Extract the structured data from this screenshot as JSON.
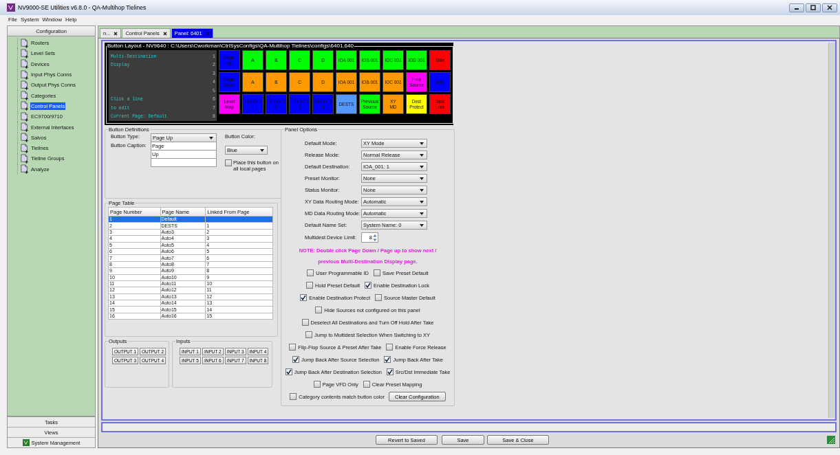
{
  "window": {
    "title": "NV9000-SE Utilities v6.8.0 - QA-Multihop Tielines"
  },
  "menu": [
    "File",
    "System",
    "Window",
    "Help"
  ],
  "sidebar": {
    "header": "Configuration",
    "items": [
      {
        "label": "Routers",
        "selected": false
      },
      {
        "label": "Level Sets",
        "selected": false
      },
      {
        "label": "Devices",
        "selected": false
      },
      {
        "label": "Input Phys Conns",
        "selected": false
      },
      {
        "label": "Output Phys Conns",
        "selected": false
      },
      {
        "label": "Categories",
        "selected": false
      },
      {
        "label": "Control Panels",
        "selected": true
      },
      {
        "label": "EC9700/9710",
        "selected": false
      },
      {
        "label": "External Interfaces",
        "selected": false
      },
      {
        "label": "Salvos",
        "selected": false
      },
      {
        "label": "Tielines",
        "selected": false
      },
      {
        "label": "Tieline Groups",
        "selected": false
      },
      {
        "label": "Analyze",
        "selected": false
      }
    ],
    "footer": [
      {
        "label": "Tasks"
      },
      {
        "label": "Views"
      },
      {
        "label": "System Management",
        "kind": "logo"
      }
    ]
  },
  "tabs": [
    {
      "label": "n...",
      "selected": false
    },
    {
      "label": "Control Panels",
      "selected": false
    },
    {
      "label": "Panel: 6401",
      "selected": true
    }
  ],
  "button_layout": {
    "title": "Button Layout - NV9640 : C:\\Users\\Cworkman\\CtrlSysConfigs\\QA-Multihop Tielines\\configs\\6401.640",
    "display_lines": [
      {
        "number": "1",
        "text": "Multi-Destination"
      },
      {
        "number": "2",
        "text": "Display"
      },
      {
        "number": "3"
      },
      {
        "number": "4"
      },
      {
        "number": "5"
      },
      {
        "number": "6",
        "text": "Click a line"
      },
      {
        "number": "7",
        "text": "to edit"
      },
      {
        "number": "8",
        "text": "Current Page: Default"
      }
    ],
    "buttons": [
      {
        "caption": [
          "Page",
          "Up"
        ],
        "color": "#0000ff"
      },
      {
        "caption": [
          "A"
        ],
        "color": "#00ff00"
      },
      {
        "caption": [
          "B"
        ],
        "color": "#00ff00"
      },
      {
        "caption": [
          "C"
        ],
        "color": "#00ff00"
      },
      {
        "caption": [
          "D"
        ],
        "color": "#00ff00"
      },
      {
        "caption": [
          "IOA 001"
        ],
        "color": "#00ff00"
      },
      {
        "caption": [
          "IOB 001"
        ],
        "color": "#00ff00"
      },
      {
        "caption": [
          "IOC 001"
        ],
        "color": "#00ff00"
      },
      {
        "caption": [
          "IOD 001"
        ],
        "color": "#00ff00"
      },
      {
        "caption": [
          "Take"
        ],
        "color": "#ff0000"
      },
      {
        "caption": [
          "Page",
          "Down"
        ],
        "color": "#0000ff"
      },
      {
        "caption": [
          "A"
        ],
        "color": "#ff9900"
      },
      {
        "caption": [
          "B"
        ],
        "color": "#ff9900"
      },
      {
        "caption": [
          "C"
        ],
        "color": "#ff9900"
      },
      {
        "caption": [
          "D"
        ],
        "color": "#ff9900"
      },
      {
        "caption": [
          "IOA 001"
        ],
        "color": "#ff9900"
      },
      {
        "caption": [
          "IOB 001"
        ],
        "color": "#ff9900"
      },
      {
        "caption": [
          "IOC 001"
        ],
        "color": "#ff9900"
      },
      {
        "caption": [
          "Free",
          "Source"
        ],
        "color": "#ff00ff"
      },
      {
        "caption": [
          "Info"
        ],
        "color": "#0000ff"
      },
      {
        "caption": [
          "Level",
          "Map"
        ],
        "color": "#ff00ff"
      },
      {
        "caption": [
          "SELECT",
          "1"
        ],
        "color": "#0000ff"
      },
      {
        "caption": [
          "SELECT",
          "2"
        ],
        "color": "#0000ff"
      },
      {
        "caption": [
          "SELECT",
          "3"
        ],
        "color": "#0000ff"
      },
      {
        "caption": [
          "SELECT",
          "4"
        ],
        "color": "#0000ff"
      },
      {
        "caption": [
          "DESTS"
        ],
        "color": "#5599ff"
      },
      {
        "caption": [
          "Previous",
          "Source"
        ],
        "color": "#00ff00"
      },
      {
        "caption": [
          "XY",
          "MD"
        ],
        "color": "#ff9900"
      },
      {
        "caption": [
          "Dest",
          "Protect"
        ],
        "color": "#ffff00"
      },
      {
        "caption": [
          "Dest",
          "Lock"
        ],
        "color": "#ff0000"
      }
    ]
  },
  "button_definitions": {
    "title": "Button Definitions",
    "type_label": "Button Type:",
    "type_value": "Page Up",
    "caption_label": "Button Caption:",
    "caption_lines": [
      "Page",
      "Up"
    ],
    "color_label": "Button Color:",
    "color_value": "Blue",
    "all_pages": {
      "label": "Place this button on all local pages",
      "checked": false
    }
  },
  "page_table": {
    "title": "Page Table",
    "columns": [
      "Page Number",
      "Page Name",
      "Linked From Page"
    ],
    "rows": [
      {
        "cells": [
          "1",
          "Default"
        ],
        "selected": true
      },
      {
        "cells": [
          "2",
          "DESTS",
          "1"
        ],
        "selected": false
      },
      {
        "cells": [
          "3",
          "Auto3",
          "2"
        ],
        "selected": false
      },
      {
        "cells": [
          "4",
          "Auto4",
          "3"
        ],
        "selected": false
      },
      {
        "cells": [
          "5",
          "Auto5",
          "4"
        ],
        "selected": false
      },
      {
        "cells": [
          "6",
          "Auto6",
          "5"
        ],
        "selected": false
      },
      {
        "cells": [
          "7",
          "Auto7",
          "6"
        ],
        "selected": false
      },
      {
        "cells": [
          "8",
          "Auto8",
          "7"
        ],
        "selected": false
      },
      {
        "cells": [
          "9",
          "Auto9",
          "8"
        ],
        "selected": false
      },
      {
        "cells": [
          "10",
          "Auto10",
          "9"
        ],
        "selected": false
      },
      {
        "cells": [
          "11",
          "Auto11",
          "10"
        ],
        "selected": false
      },
      {
        "cells": [
          "12",
          "Auto12",
          "11"
        ],
        "selected": false
      },
      {
        "cells": [
          "13",
          "Auto13",
          "12"
        ],
        "selected": false
      },
      {
        "cells": [
          "14",
          "Auto14",
          "13"
        ],
        "selected": false
      },
      {
        "cells": [
          "15",
          "Auto15",
          "14"
        ],
        "selected": false
      },
      {
        "cells": [
          "16",
          "Auto16",
          "15"
        ],
        "selected": false
      }
    ]
  },
  "outputs": {
    "title": "Outputs",
    "buttons": [
      "OUTPUT 1",
      "OUTPUT 2",
      "OUTPUT 3",
      "OUTPUT 4"
    ]
  },
  "inputs": {
    "title": "Inputs",
    "buttons": [
      "INPUT 1",
      "INPUT 2",
      "INPUT 3",
      "INPUT 4",
      "INPUT 5",
      "INPUT 6",
      "INPUT 7",
      "INPUT 8"
    ]
  },
  "panel_options": {
    "title": "Panel Options",
    "fields": [
      {
        "label": "Default Mode:",
        "value": "XY Mode"
      },
      {
        "label": "Release Mode:",
        "value": "Normal Release"
      },
      {
        "label": "Default Destination:",
        "value": "IOA_001: 1"
      },
      {
        "label": "Preset Monitor:",
        "value": "None"
      },
      {
        "label": "Status Monitor:",
        "value": "None"
      },
      {
        "label": "XY Data Routing Mode:",
        "value": "Automatic"
      },
      {
        "label": "MD Data Routing Mode:",
        "value": "Automatic"
      },
      {
        "label": "Default Name Set:",
        "value": "System Name: 0"
      }
    ],
    "device_limit": {
      "label": "Multidest Device Limit:",
      "value": "8"
    },
    "note_lines": [
      "NOTE: Double click Page Down / Page up to show next /",
      "previous Multi-Destination Display page."
    ],
    "checkbox_rows": [
      [
        {
          "label": "User Programmable ID",
          "checked": false
        },
        {
          "label": "Save Preset Default",
          "checked": false
        }
      ],
      [
        {
          "label": "Hold Preset Default",
          "checked": false
        },
        {
          "label": "Enable Destination Lock",
          "checked": true
        }
      ],
      [
        {
          "label": "Enable Destination Protect",
          "checked": true
        },
        {
          "label": "Source Master Default",
          "checked": false
        }
      ],
      [
        {
          "label": "Hide Sources not configured on this panel",
          "checked": false
        }
      ],
      [
        {
          "label": "Deselect All Destinations and Turn Off Hold After Take",
          "checked": false
        }
      ],
      [
        {
          "label": "Jump to Multidest Selection When Switching to XY",
          "checked": false
        }
      ],
      [
        {
          "label": "Flip-Flop Source & Preset After Take",
          "checked": false
        },
        {
          "label": "Enable Force Release",
          "checked": false
        }
      ],
      [
        {
          "label": "Jump Back After Source Selection",
          "checked": true
        },
        {
          "label": "Jump Back After Take",
          "checked": true
        }
      ],
      [
        {
          "label": "Jump Back After Destination Selection",
          "checked": true
        },
        {
          "label": "Src/Dst Immediate Take",
          "checked": true
        }
      ],
      [
        {
          "label": "Page VFD Only",
          "checked": false
        },
        {
          "label": "Clear Preset Mapping",
          "checked": false
        }
      ]
    ],
    "last_checkbox": {
      "label": "Category contents match button color",
      "checked": false
    },
    "clear_button": "Clear Configuration"
  },
  "footer_buttons": [
    "Revert to Saved",
    "Save",
    "Save & Close"
  ]
}
